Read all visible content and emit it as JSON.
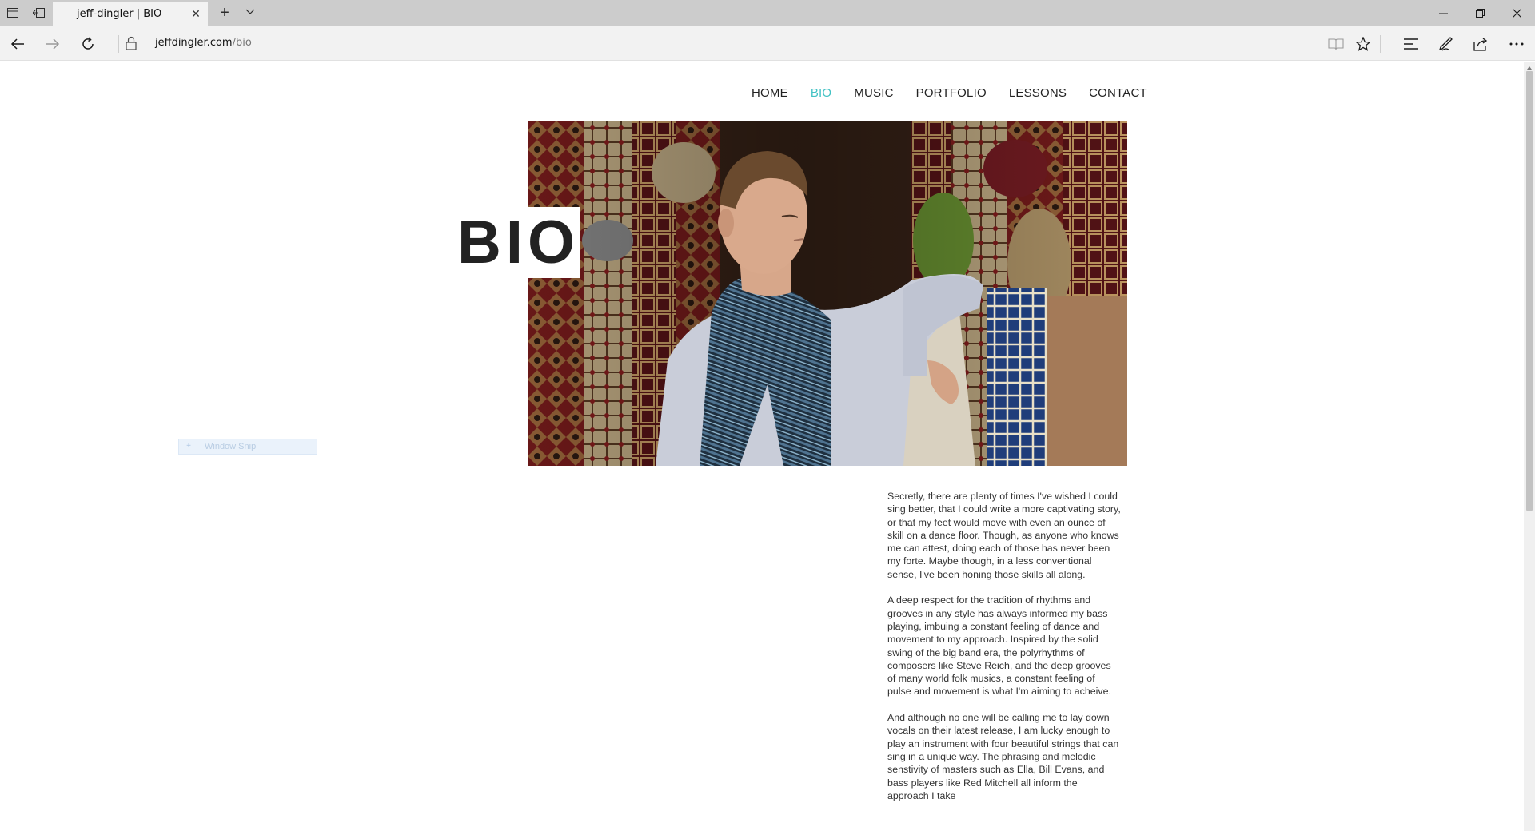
{
  "browser": {
    "tab_title": "jeff-dingler | BIO",
    "url_domain": "jeffdingler.com",
    "url_path": "/bio"
  },
  "nav": {
    "items": [
      {
        "label": "HOME",
        "active": false
      },
      {
        "label": "BIO",
        "active": true
      },
      {
        "label": "MUSIC",
        "active": false
      },
      {
        "label": "PORTFOLIO",
        "active": false
      },
      {
        "label": "LESSONS",
        "active": false
      },
      {
        "label": "CONTACT",
        "active": false
      }
    ],
    "accent_color": "#43c2c4"
  },
  "hero": {
    "title": "BIO",
    "image_subject": "portrait of a man wearing a striped scarf seated among stacked rolled rugs"
  },
  "overlay": {
    "snip_label": "Window Snip"
  },
  "bio": {
    "paragraphs": [
      "Secretly, there are plenty of times I've wished I could sing better, that I could write a more captivating story, or that my feet would move with even an ounce of skill on a dance floor. Though, as anyone who knows me can attest, doing each of those has never been my forte. Maybe though, in a less conventional sense, I've been honing those skills all along.",
      "A deep respect for the tradition of rhythms and grooves in any style has always informed my bass playing, imbuing a constant feeling of dance and movement to my approach. Inspired by the solid swing of the big band era, the polyrhythms of composers like Steve Reich, and the deep grooves of many world folk musics, a constant feeling of pulse and movement is what I'm aiming to acheive.",
      "And although no one will be calling me to lay down vocals on their latest release,  I am lucky enough to play an instrument with four beautiful strings that can sing in a unique way. The phrasing and melodic senstivity of masters such as Ella, Bill Evans, and bass players like Red Mitchell all inform the approach I take"
    ]
  }
}
